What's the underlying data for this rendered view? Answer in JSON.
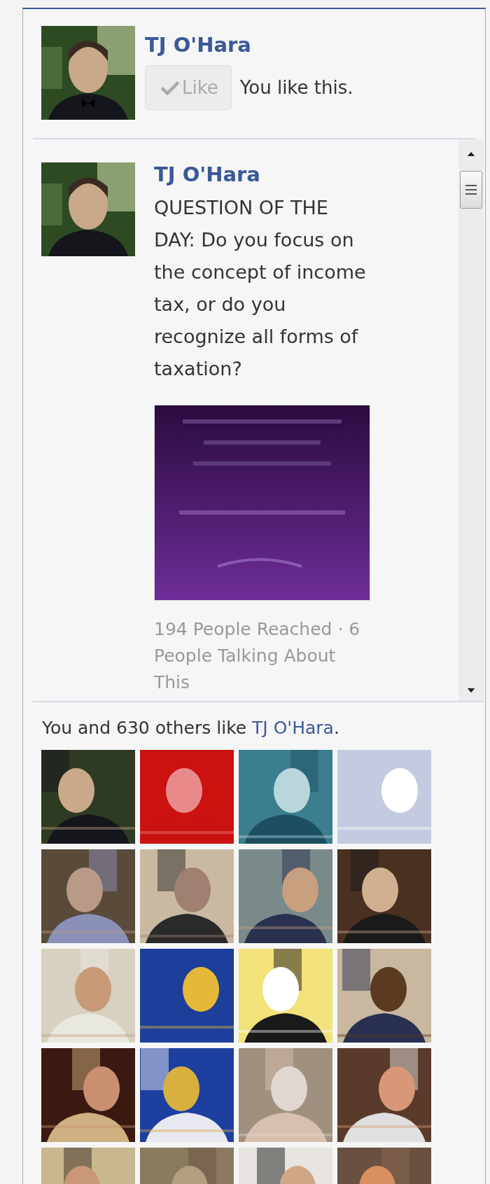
{
  "header": {
    "page_name": "TJ O'Hara",
    "like_button": {
      "label": "Like",
      "liked": true
    },
    "status": "You like this."
  },
  "stream": {
    "posts": [
      {
        "author": "TJ O'Hara",
        "text": "QUESTION OF THE DAY: Do you focus on the concept of income tax, or do you recognize all forms of taxation?",
        "stats": "194 People Reached · 6 People Talking About This"
      }
    ]
  },
  "likes_summary": {
    "text_before": "You and 630 others like ",
    "link": "TJ O'Hara",
    "text_after": "."
  }
}
